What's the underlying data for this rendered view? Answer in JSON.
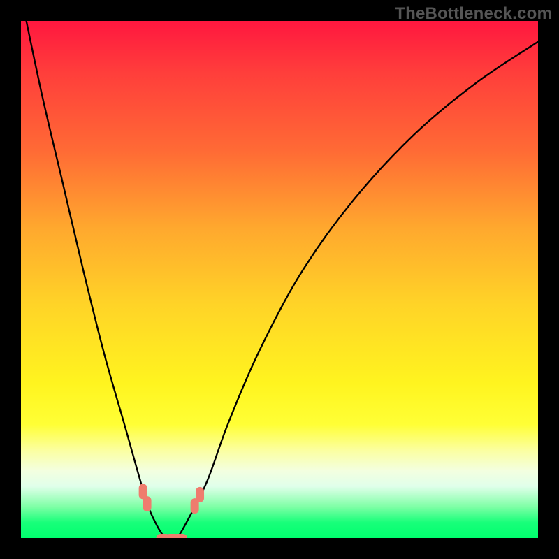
{
  "watermark": "TheBottleneck.com",
  "chart_data": {
    "type": "line",
    "title": "",
    "xlabel": "",
    "ylabel": "",
    "ylim": [
      0,
      100
    ],
    "xlim": [
      0,
      100
    ],
    "series": [
      {
        "name": "bottleneck-curve",
        "x": [
          0,
          4,
          8,
          12,
          16,
          20,
          24,
          26,
          28,
          30,
          32,
          36,
          40,
          46,
          54,
          64,
          76,
          88,
          100
        ],
        "y": [
          105,
          86,
          69,
          52,
          36,
          22,
          8,
          3,
          0,
          0,
          3,
          11,
          22,
          36,
          51,
          65,
          78,
          88,
          96
        ]
      }
    ],
    "markers": [
      {
        "name": "left-branch-marker-1",
        "x": 23.6,
        "y": 9.0
      },
      {
        "name": "left-branch-marker-2",
        "x": 24.4,
        "y": 6.6
      },
      {
        "name": "valley-marker-1",
        "x": 27.5,
        "y": 0.0
      },
      {
        "name": "valley-marker-2",
        "x": 29.3,
        "y": 0.0
      },
      {
        "name": "valley-marker-3",
        "x": 30.8,
        "y": 0.0
      },
      {
        "name": "right-branch-marker-1",
        "x": 33.6,
        "y": 6.2
      },
      {
        "name": "right-branch-marker-2",
        "x": 34.6,
        "y": 8.4
      }
    ],
    "background_gradient": {
      "top": "#ff173f",
      "bottom": "#00ff6e",
      "meaning": "red=high bottleneck, green=no bottleneck"
    }
  }
}
